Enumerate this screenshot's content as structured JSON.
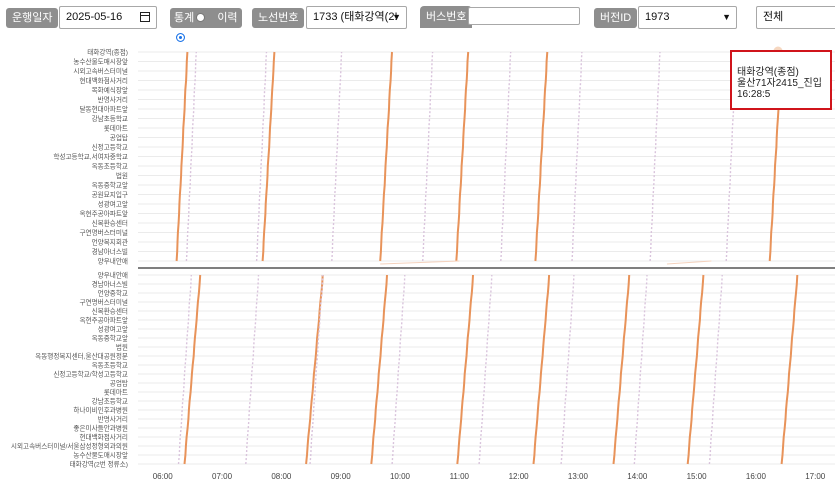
{
  "toolbar": {
    "date_label": "운행일자",
    "date_value": "2025-05-16",
    "stat_label": "통계",
    "history_label": "이력",
    "route_label": "노선번호",
    "route_value": "1733 (태화강역(2!",
    "bus_label": "버스번호",
    "bus_value": "",
    "version_label": "버전ID",
    "version_value": "1973",
    "filter_value": "전체"
  },
  "tooltip": {
    "line1": "태화강역(종점)",
    "line2": "울산71자2415_진입",
    "line3": "16:28:5"
  },
  "colors": {
    "forward_line": "#e8935a",
    "backward_line": "#d9c4dc",
    "tag_bg": "#8e8e8e",
    "tooltip_border": "#d0141b"
  },
  "chart_data": {
    "type": "line",
    "x_ticks": [
      "06:00",
      "07:00",
      "08:00",
      "09:00",
      "10:00",
      "11:00",
      "12:00",
      "13:00",
      "14:00",
      "15:00",
      "16:00",
      "17:00"
    ],
    "x_range": [
      "05:35",
      "17:20"
    ],
    "stops_upper": [
      "태화강역(종점)",
      "농수산물도매시장앞",
      "시외고속버스터미널",
      "현대백화점사거리",
      "목화예식장앞",
      "반명사거리",
      "달동현대아파트앞",
      "강남초등학교",
      "롯데마트",
      "공업탑",
      "신정고등학교",
      "학성고등학교,서여자중학교",
      "옥동초등학교",
      "법원",
      "옥동중학교앞",
      "공원묘지입구",
      "성광여고앞",
      "옥현주공아파트앞",
      "신복환승센터",
      "구연명버스터미널",
      "언양복지회관",
      "경남아너스빌",
      "양우내안애"
    ],
    "stops_lower": [
      "양우내안애",
      "경남아너스빌",
      "언양중학교",
      "구연명버스터미널",
      "신복환승센터",
      "옥현주공아파트앞",
      "성광여고앞",
      "옥동중학교앞",
      "법원",
      "옥동행정복지센터,울산대공원정문",
      "옥동초등학교",
      "신정고등학교/학성고등학교",
      "공업탑",
      "롯데마트",
      "강남초등학교",
      "하나이비인후과병원",
      "반명사거리",
      "좋은미사들안과병원",
      "현대백화점사거리",
      "시외고속버스터미널/서울삼성정형외과의원",
      "농수산물도매시장앞",
      "태화강역(2번 정류소)"
    ],
    "series": [
      {
        "values": [
          [
            "06:14",
            "06:25"
          ],
          [
            "07:41",
            "07:53"
          ],
          [
            "09:40",
            "09:52"
          ],
          [
            "10:57",
            "11:09"
          ],
          [
            "12:17",
            "12:29"
          ],
          [
            "16:14",
            "16:26"
          ]
        ]
      },
      {
        "values": [
          [
            "06:24",
            "06:34"
          ],
          [
            "07:35",
            "07:45"
          ],
          [
            "08:51",
            "09:01"
          ],
          [
            "10:23",
            "10:33"
          ],
          [
            "11:42",
            "11:52"
          ],
          [
            "12:54",
            "13:04"
          ],
          [
            "14:13",
            "14:23"
          ],
          [
            "15:30",
            "15:40"
          ]
        ]
      },
      {
        "values": [
          [
            "06:22",
            "06:38"
          ],
          [
            "08:25",
            "08:42"
          ],
          [
            "09:31",
            "09:47"
          ],
          [
            "10:58",
            "11:14"
          ],
          [
            "12:15",
            "12:31"
          ],
          [
            "13:36",
            "13:52"
          ],
          [
            "14:51",
            "15:07"
          ],
          [
            "16:26",
            "16:42"
          ]
        ]
      },
      {
        "values": [
          [
            "06:16",
            "06:29"
          ],
          [
            "07:24",
            "07:37"
          ],
          [
            "08:29",
            "08:42"
          ],
          [
            "09:52",
            "10:05"
          ],
          [
            "11:20",
            "11:33"
          ],
          [
            "12:43",
            "12:56"
          ],
          [
            "13:57",
            "14:10"
          ],
          [
            "15:13",
            "15:26"
          ]
        ]
      }
    ]
  }
}
